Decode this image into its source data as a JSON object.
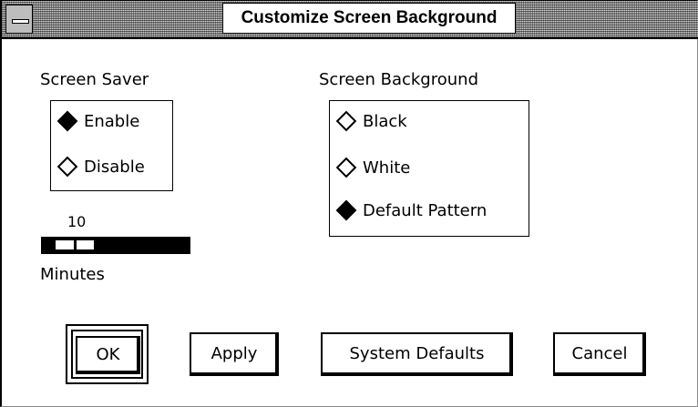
{
  "window": {
    "title": "Customize Screen Background"
  },
  "screen_saver": {
    "label": "Screen Saver",
    "options": [
      {
        "label": "Enable",
        "selected": true
      },
      {
        "label": "Disable",
        "selected": false
      }
    ],
    "timeout_value": "10",
    "timeout_unit_label": "Minutes",
    "slider_fraction": 0.1
  },
  "screen_background": {
    "label": "Screen Background",
    "options": [
      {
        "label": "Black",
        "selected": false
      },
      {
        "label": "White",
        "selected": false
      },
      {
        "label": "Default Pattern",
        "selected": true
      }
    ]
  },
  "buttons": {
    "ok": "OK",
    "apply": "Apply",
    "system_defaults": "System Defaults",
    "cancel": "Cancel"
  },
  "icons": {
    "window_menu": "window-menu-icon",
    "radio_on": "diamond-filled-icon",
    "radio_off": "diamond-empty-icon"
  },
  "colors": {
    "foreground": "#000000",
    "background": "#ffffff",
    "title_pattern": "#8a8a8a"
  }
}
